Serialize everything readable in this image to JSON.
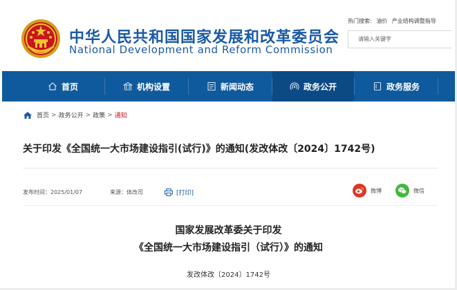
{
  "header": {
    "site_name_cn": "中华人民共和国国家发展和改革委员会",
    "site_name_en": "National Development and Reform Commission",
    "hot_search_label": "热门搜索:",
    "hot_search_items": [
      "油价",
      "产业结构调整指导"
    ],
    "search_placeholder": "请输入关键字"
  },
  "nav": {
    "items": [
      {
        "label": "首页",
        "icon": "home-icon"
      },
      {
        "label": "机构设置",
        "icon": "building-icon"
      },
      {
        "label": "新闻动态",
        "icon": "news-icon"
      },
      {
        "label": "政务公开",
        "icon": "broadcast-icon"
      },
      {
        "label": "政务服务",
        "icon": "document-icon"
      }
    ],
    "active_index": 3
  },
  "breadcrumb": {
    "items": [
      "首页",
      "政务公开",
      "政策",
      "通知"
    ],
    "separator": ">"
  },
  "article": {
    "title": "关于印发《全国统一大市场建设指引(试行)》的通知(发改体改〔2024〕1742号)",
    "publish_label": "发布时间：2025/01/07",
    "source_label": "来源：体改司",
    "print_label": "[打印]",
    "share": [
      {
        "label": "微博",
        "icon": "weibo-icon",
        "color": "#e0342a"
      },
      {
        "label": "微信",
        "icon": "wechat-icon",
        "color": "#3fb83b"
      }
    ],
    "doc_heading_1": "国家发展改革委关于印发",
    "doc_heading_2": "《全国统一大市场建设指引（试行）》的通知",
    "doc_number": "发改体改〔2024〕1742号"
  },
  "colors": {
    "brand_blue": "#1a5aa6",
    "nav_bg": "#0f5a9c",
    "nav_active": "#0b4a85",
    "accent_red": "#c8161d"
  }
}
